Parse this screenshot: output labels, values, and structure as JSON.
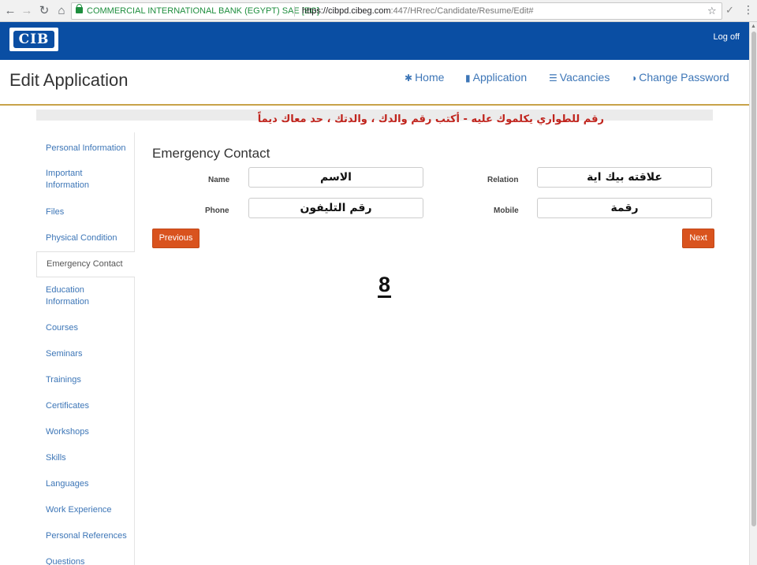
{
  "browser": {
    "site_name": "COMMERCIAL INTERNATIONAL BANK (EGYPT) SAE [EG]",
    "url_host": "https://cibpd.cibeg.com",
    "url_path": ":447/HRrec/Candidate/Resume/Edit#",
    "back_glyph": "←",
    "forward_glyph": "→",
    "reload_glyph": "↻",
    "home_glyph": "⌂",
    "star_glyph": "☆",
    "ext_glyph": "✓",
    "menu_glyph": "⋮"
  },
  "banner": {
    "logo_text": "CIB",
    "logoff_label": "Log off"
  },
  "header": {
    "title": "Edit Application",
    "nav": [
      {
        "label": "Home",
        "icon": "gear-icon",
        "glyph": "✱"
      },
      {
        "label": "Application",
        "icon": "document-icon",
        "glyph": "▮"
      },
      {
        "label": "Vacancies",
        "icon": "list-icon",
        "glyph": "☰"
      },
      {
        "label": "Change Password",
        "icon": "contrast-icon",
        "glyph": "◑"
      }
    ]
  },
  "notice": "رقم للطواري يكلموك عليه - أكتب رقم والدك ، والدتك ، حد معاك ديماً",
  "sidebar": {
    "items": [
      {
        "label": "Personal Information"
      },
      {
        "label": "Important Information"
      },
      {
        "label": "Files"
      },
      {
        "label": "Physical Condition"
      },
      {
        "label": "Emergency Contact"
      },
      {
        "label": "Education Information"
      },
      {
        "label": "Courses"
      },
      {
        "label": "Seminars"
      },
      {
        "label": "Trainings"
      },
      {
        "label": "Certificates"
      },
      {
        "label": "Workshops"
      },
      {
        "label": "Skills"
      },
      {
        "label": "Languages"
      },
      {
        "label": "Work Experience"
      },
      {
        "label": "Personal References"
      },
      {
        "label": "Questions"
      }
    ],
    "active": "Emergency Contact"
  },
  "form": {
    "section_title": "Emergency Contact",
    "fields": {
      "name": {
        "label": "Name",
        "value": "الاسم"
      },
      "relation": {
        "label": "Relation",
        "value": "علاقته بيك اية"
      },
      "phone": {
        "label": "Phone",
        "value": "رقم التليفون"
      },
      "mobile": {
        "label": "Mobile",
        "value": "رقمة"
      }
    },
    "previous_label": "Previous",
    "next_label": "Next"
  },
  "annotation": "8",
  "colors": {
    "banner": "#0a4ea3",
    "accent_line": "#c8a34a",
    "link": "#3d76b7",
    "button": "#d9531e",
    "notice": "#c0241d"
  }
}
